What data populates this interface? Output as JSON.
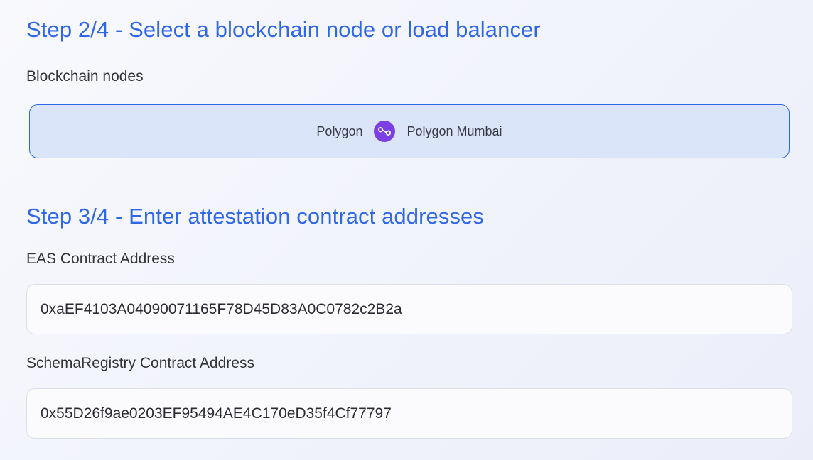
{
  "step2": {
    "title": "Step 2/4 - Select a blockchain node or load balancer",
    "nodes_label": "Blockchain nodes",
    "selected_node": {
      "network": "Polygon",
      "icon": "polygon-logo-icon",
      "name": "Polygon Mumbai",
      "selected": true
    }
  },
  "step3": {
    "title": "Step 3/4 - Enter attestation contract addresses",
    "eas": {
      "label": "EAS Contract Address",
      "value": "0xaEF4103A04090071165F78D45D83A0C0782c2B2a"
    },
    "schema_registry": {
      "label": "SchemaRegistry Contract Address",
      "value": "0x55D26f9ae0203EF95494AE4C170eD35f4Cf77797"
    }
  },
  "colors": {
    "accent": "#2f67e6",
    "selected_bg": "#dbe5fa",
    "polygon_purple": "#7b3fe4"
  }
}
